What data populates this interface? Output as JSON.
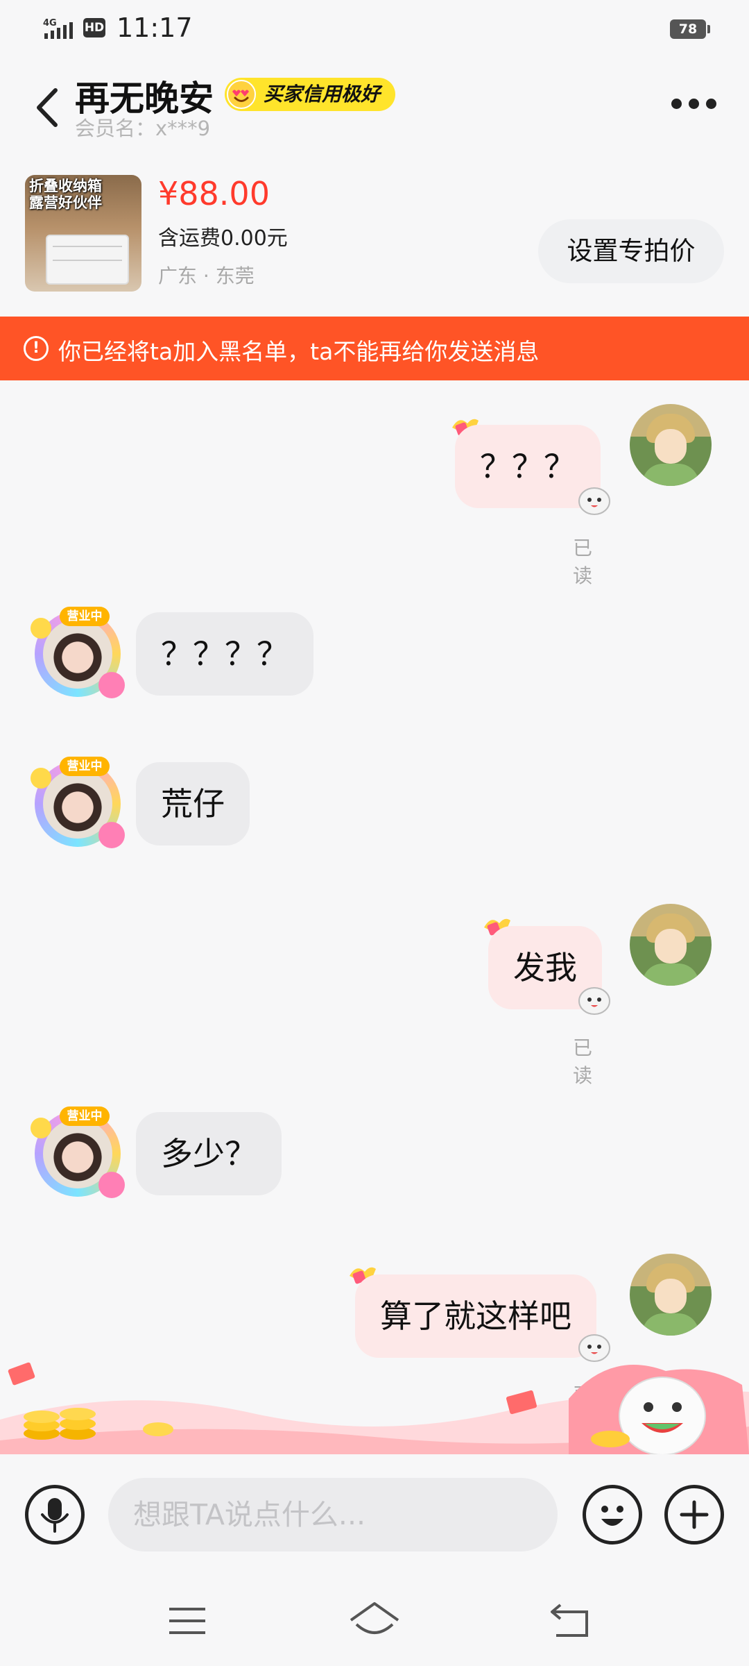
{
  "status_bar": {
    "network": "4G",
    "hd": "HD",
    "time": "11:17",
    "battery": "78"
  },
  "header": {
    "title": "再无晚安",
    "credit_badge": "买家信用极好",
    "member_label": "会员名：x***9"
  },
  "product": {
    "thumb_caption_line1": "折叠收纳箱",
    "thumb_caption_line2": "露营好伙伴",
    "price": "¥88.00",
    "shipping": "含运费0.00元",
    "location": "广东 · 东莞",
    "set_price_button": "设置专拍价"
  },
  "banner": {
    "icon": "!",
    "text": "你已经将ta加入黑名单，ta不能再给你发送消息"
  },
  "messages": [
    {
      "side": "out",
      "text": "？？？",
      "status": "已读"
    },
    {
      "side": "in",
      "text": "？？？？"
    },
    {
      "side": "in",
      "text": "荒仔"
    },
    {
      "side": "out",
      "text": "发我",
      "status": "已读"
    },
    {
      "side": "in",
      "text": "多少？"
    },
    {
      "side": "out",
      "text": "算了就这样吧",
      "status": "已读"
    }
  ],
  "avatar_tag": "营业中",
  "input": {
    "placeholder": "想跟TA说点什么..."
  },
  "colors": {
    "accent_red": "#ff5426",
    "price_red": "#ff3a2c",
    "badge_yellow": "#ffe42b",
    "out_bubble": "#fde8e8",
    "in_bubble": "#ebebed"
  },
  "icons": [
    "back-icon",
    "more-icon",
    "warning-icon",
    "microphone-icon",
    "emoji-icon",
    "plus-icon",
    "menu-icon",
    "home-icon",
    "return-icon"
  ]
}
